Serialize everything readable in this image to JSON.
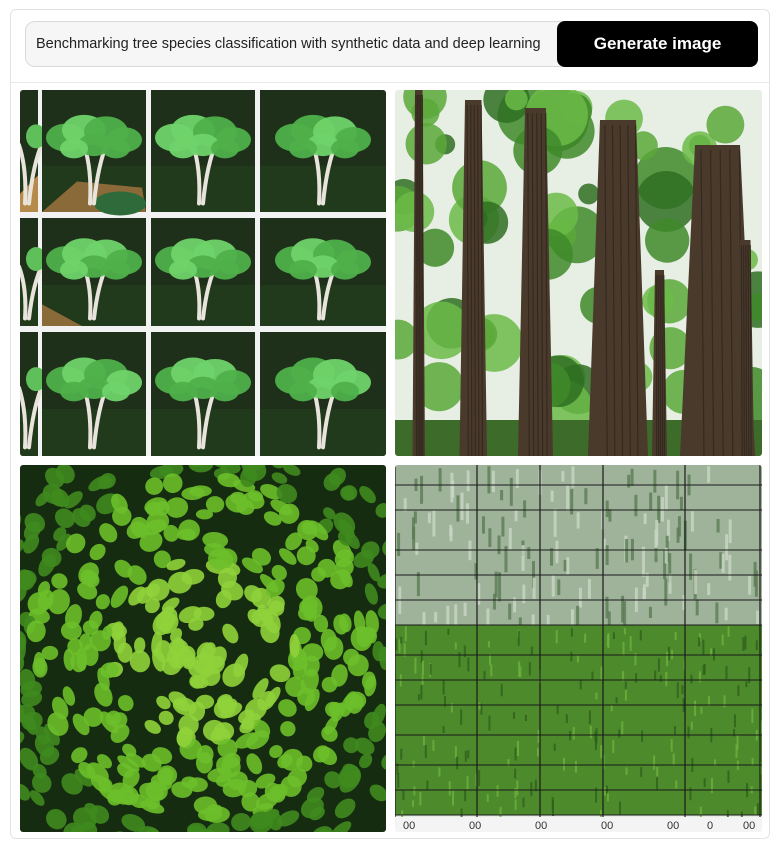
{
  "prompt": {
    "value": "Benchmarking tree species classification with synthetic data and deep learning"
  },
  "generate_button": {
    "label": "Generate image"
  },
  "colors": {
    "button_bg": "#000000",
    "leaf_green": "#5fbf3a",
    "dark_green": "#1d3a12",
    "bark": "#4a3a2c"
  },
  "gallery": {
    "images": [
      {
        "id": "tree-sprite-grid"
      },
      {
        "id": "tall-forest-trunks"
      },
      {
        "id": "aerial-forest-canopy"
      },
      {
        "id": "gridded-field-pattern",
        "footer_marks": [
          "00",
          "00",
          "00",
          "00",
          "00",
          "0",
          "00"
        ]
      }
    ]
  }
}
